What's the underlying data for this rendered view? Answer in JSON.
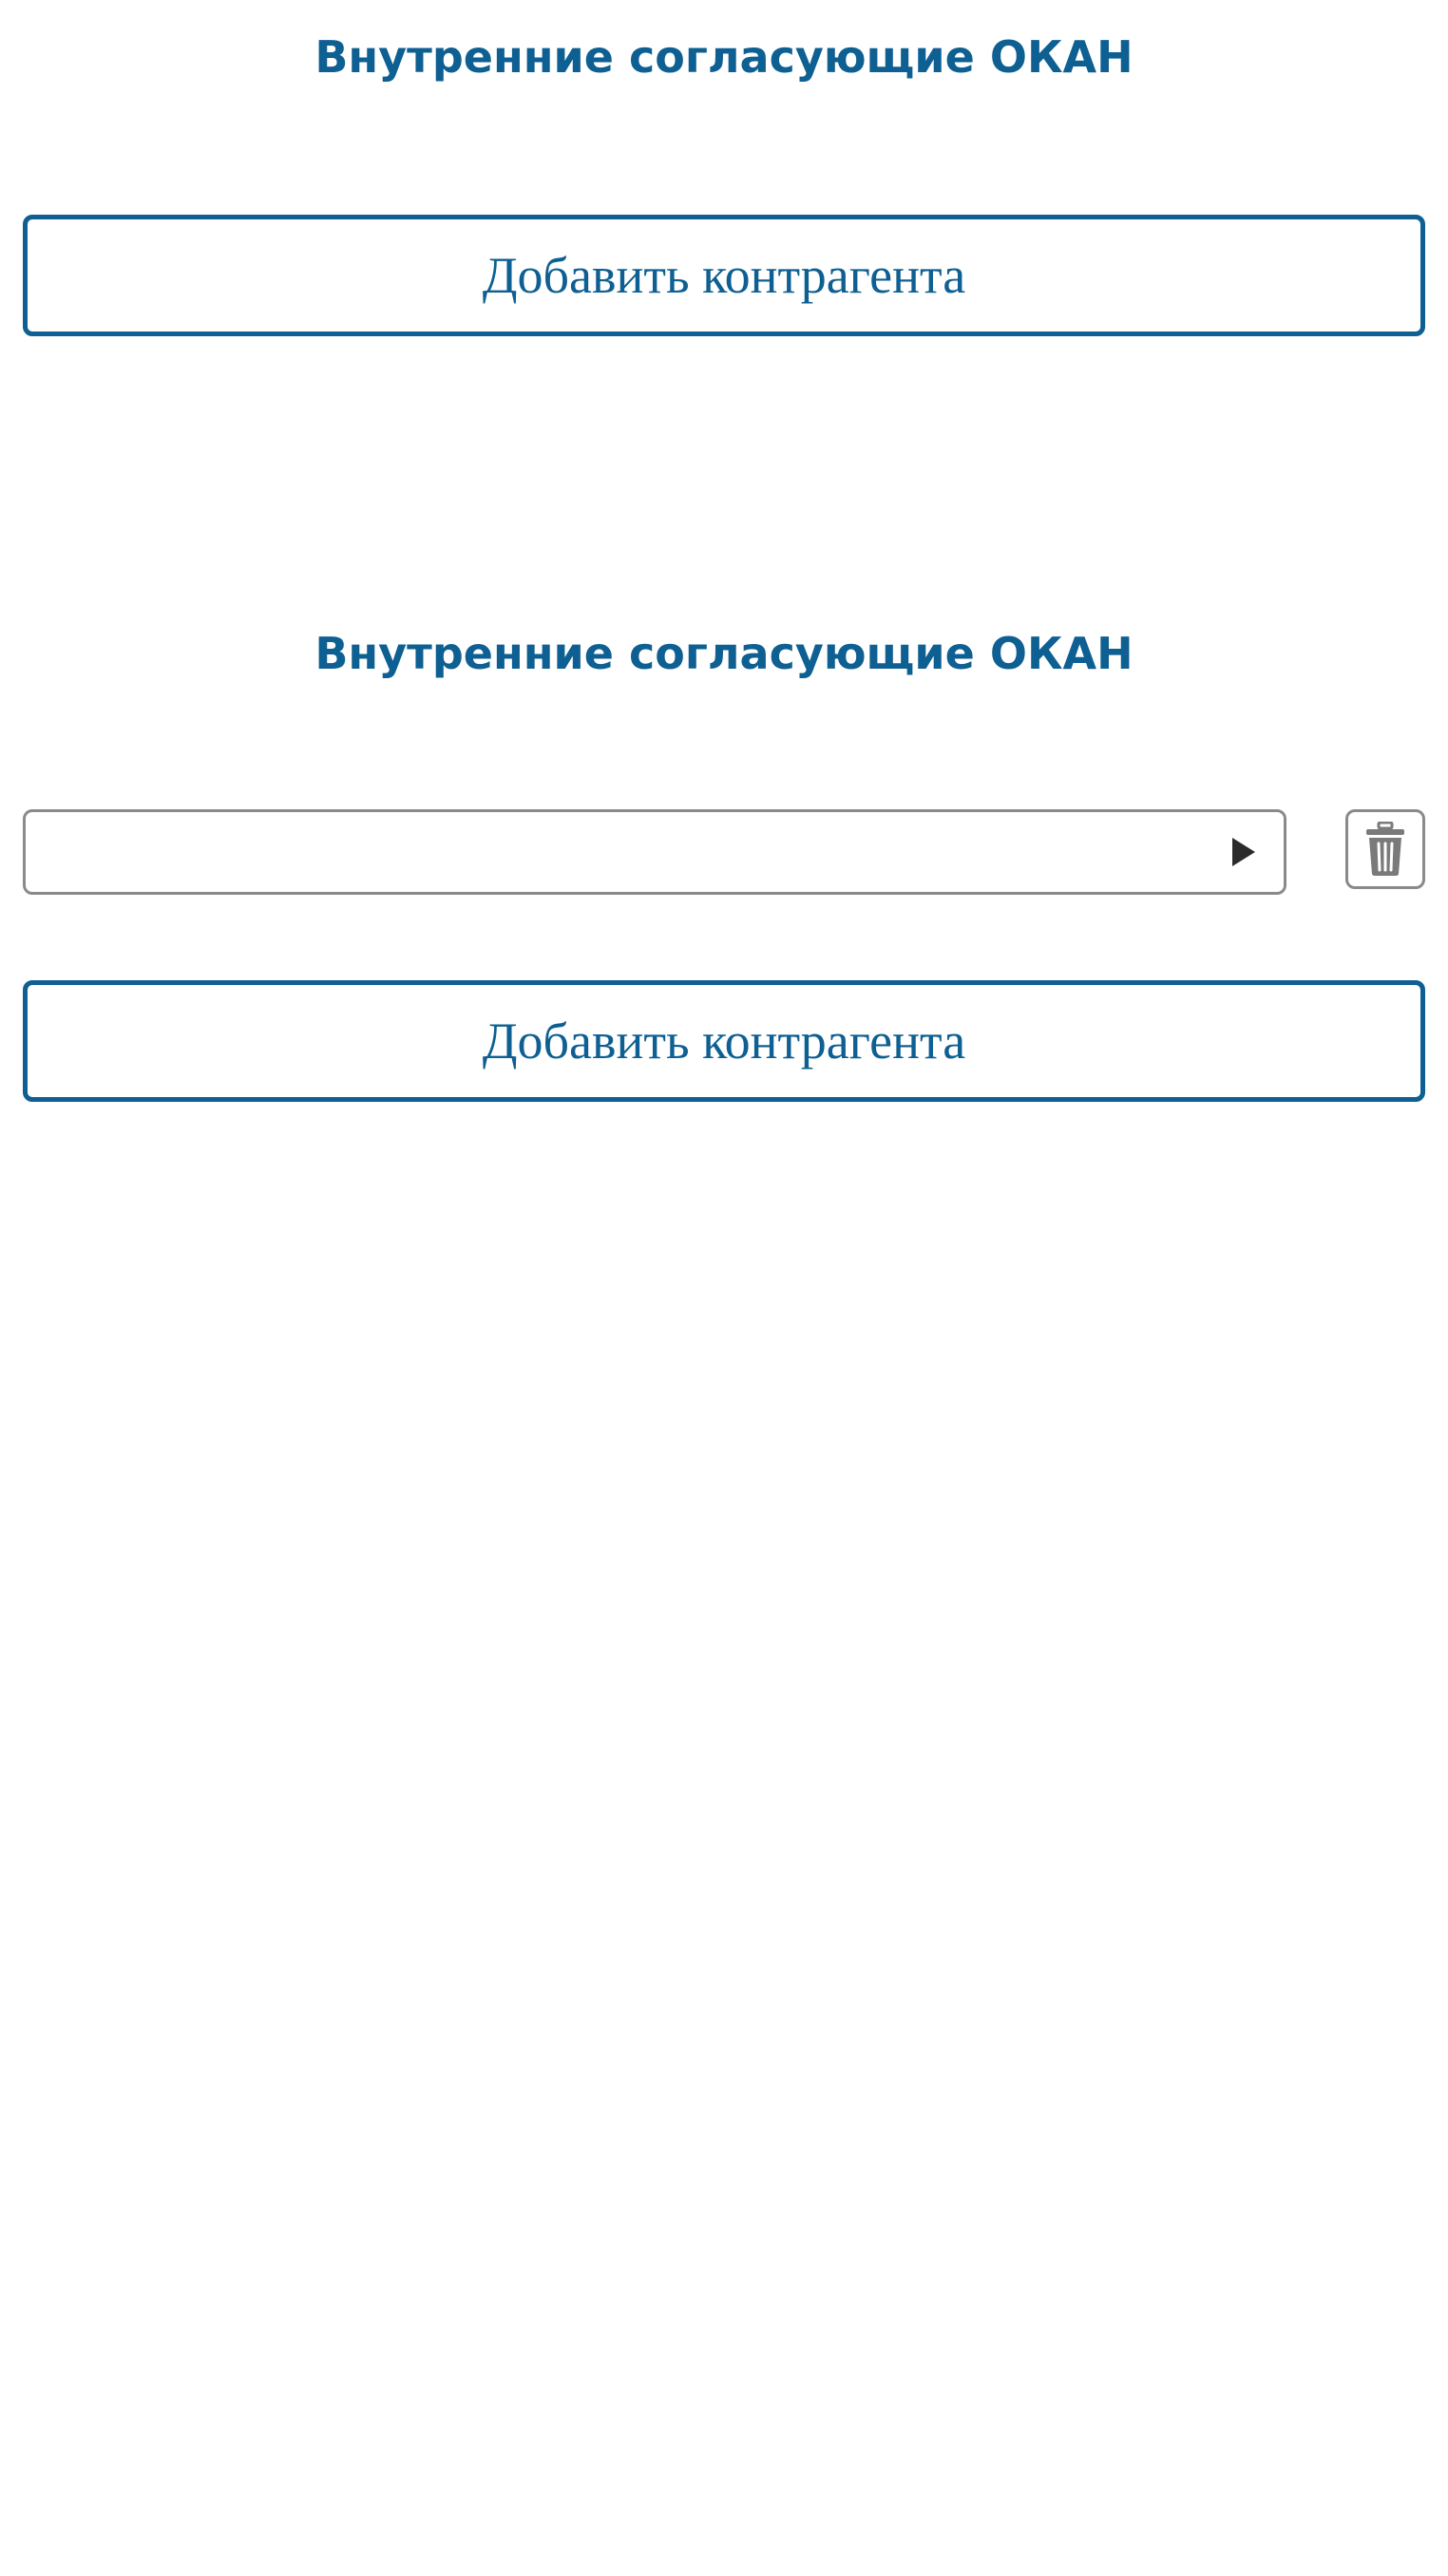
{
  "sections": [
    {
      "title": "Внутренние согласующие ОКАН",
      "add_button_label": "Добавить контрагента"
    },
    {
      "title": "Внутренние согласующие ОКАН",
      "select": {
        "value": "",
        "arrow_icon": "play-arrow-icon"
      },
      "delete_icon": "trash-icon",
      "add_button_label": "Добавить контрагента"
    }
  ],
  "colors": {
    "accent": "#0e5f92",
    "border_gray": "#8a8a8a",
    "icon_dark": "#2b2b2b",
    "icon_gray": "#7a7a7a"
  }
}
